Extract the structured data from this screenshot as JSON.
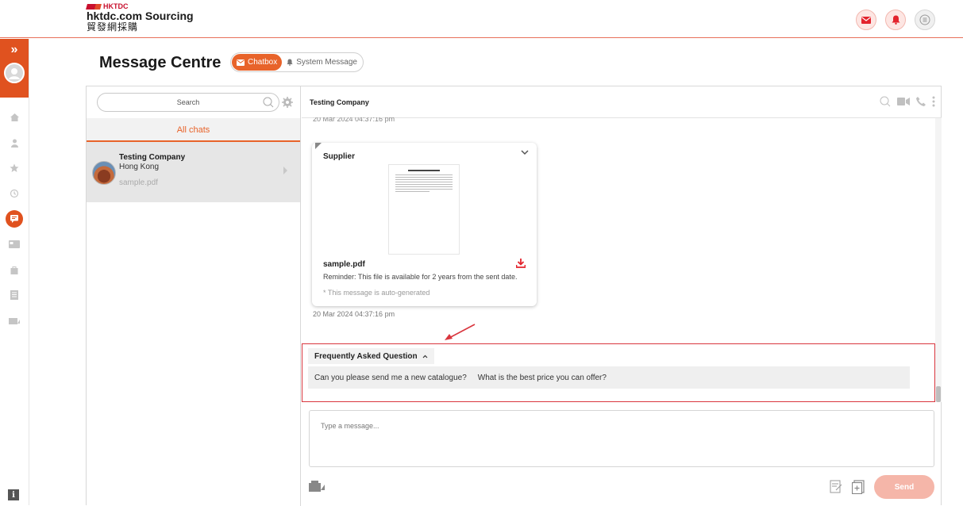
{
  "header": {
    "brand_small": "HKTDC",
    "brand_name": "hktdc.com Sourcing",
    "brand_cn": "貿發網採購",
    "icons": [
      "mail-icon",
      "bell-icon",
      "menu-icon"
    ]
  },
  "rail": {
    "items": [
      "home-icon",
      "user-icon",
      "star-icon",
      "history-icon",
      "chat-icon",
      "card-icon",
      "bag-icon",
      "document-icon",
      "catalogue-icon"
    ],
    "active": "chat-icon"
  },
  "page": {
    "title": "Message Centre",
    "tabs": [
      {
        "label": "Chatbox",
        "active": true
      },
      {
        "label": "System Message",
        "active": false
      }
    ]
  },
  "list": {
    "search_placeholder": "Search",
    "filter_label": "All chats",
    "chats": [
      {
        "name": "Testing Company",
        "location": "Hong Kong",
        "last_message": "sample.pdf"
      }
    ]
  },
  "conversation": {
    "title": "Testing Company",
    "top_timestamp": "20 Mar 2024 04:37:16 pm",
    "message": {
      "sender": "Supplier",
      "file_name": "sample.pdf",
      "reminder": "Reminder: This file is available for 2 years from the sent date.",
      "auto_note": "* This message is auto-generated",
      "timestamp": "20 Mar 2024 04:37:16 pm"
    },
    "faq": {
      "title": "Frequently Asked Question",
      "questions": [
        "Can you please send me a new catalogue?",
        "What is the best price you can offer?"
      ]
    },
    "compose_placeholder": "Type a message...",
    "send_label": "Send"
  },
  "colors": {
    "accent": "#e8632a",
    "annotation": "#d9363e"
  }
}
